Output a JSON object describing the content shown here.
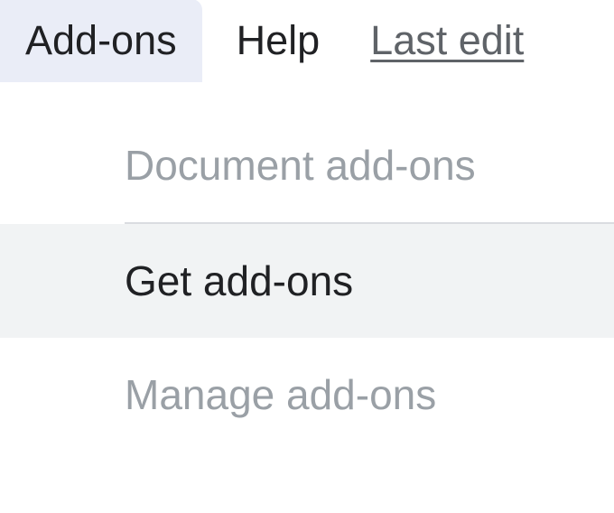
{
  "menubar": {
    "addons_label": "Add-ons",
    "help_label": "Help",
    "last_edit_label": "Last edit "
  },
  "dropdown": {
    "document_addons_label": "Document add-ons",
    "get_addons_label": "Get add-ons",
    "manage_addons_label": "Manage add-ons"
  }
}
